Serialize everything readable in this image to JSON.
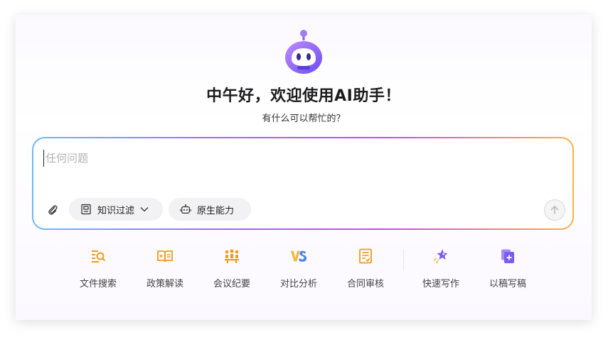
{
  "header": {
    "greeting": "中午好，欢迎使用AI助手！",
    "subtitle": "有什么可以帮忙的？"
  },
  "input": {
    "placeholder": "任何问题",
    "value": ""
  },
  "controls": {
    "knowledge_filter_label": "知识过滤",
    "native_ability_label": "原生能力"
  },
  "tools": [
    {
      "label": "文件搜索",
      "icon": "file-search-icon"
    },
    {
      "label": "政策解读",
      "icon": "policy-book-icon"
    },
    {
      "label": "会议纪要",
      "icon": "meeting-icon"
    },
    {
      "label": "对比分析",
      "icon": "vs-compare-icon"
    },
    {
      "label": "合同审核",
      "icon": "contract-review-icon"
    },
    {
      "label": "快速写作",
      "icon": "quick-write-icon"
    },
    {
      "label": "以稿写稿",
      "icon": "draft-copy-icon"
    }
  ],
  "colors": {
    "accent_orange": "#f29a1e",
    "accent_purple": "#7b5cf0",
    "robot_purple": "#8a5cf6"
  }
}
